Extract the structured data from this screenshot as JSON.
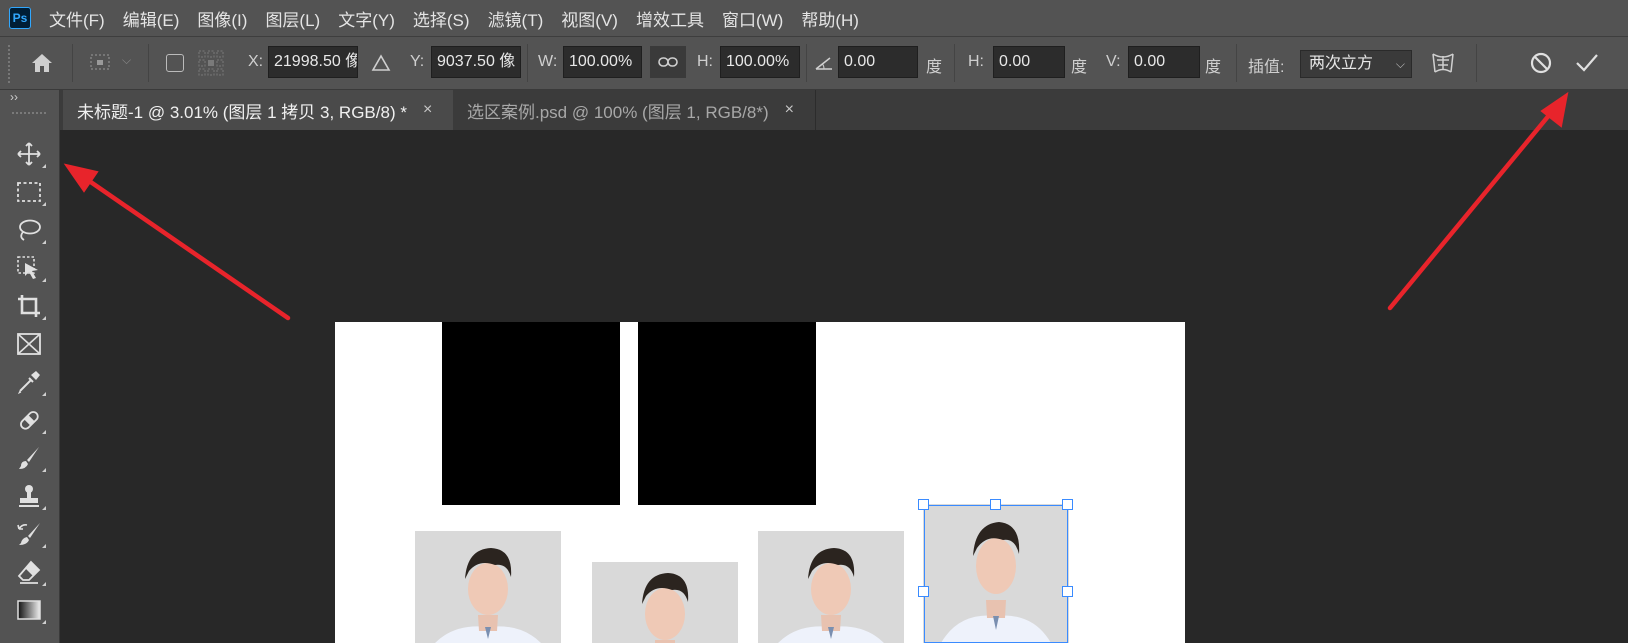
{
  "menu": {
    "items": [
      "文件(F)",
      "编辑(E)",
      "图像(I)",
      "图层(L)",
      "文字(Y)",
      "选择(S)",
      "滤镜(T)",
      "视图(V)",
      "增效工具",
      "窗口(W)",
      "帮助(H)"
    ]
  },
  "options": {
    "x_label": "X:",
    "x_value": "21998.50 像",
    "y_label": "Y:",
    "y_value": "9037.50 像",
    "w_label": "W:",
    "w_value": "100.00%",
    "h_label": "H:",
    "h_value": "100.00%",
    "angle_value": "0.00",
    "angle_unit": "度",
    "hskew_label": "H:",
    "hskew_value": "0.00",
    "hskew_unit": "度",
    "vskew_label": "V:",
    "vskew_value": "0.00",
    "vskew_unit": "度",
    "interp_label": "插值:",
    "interp_value": "两次立方"
  },
  "tabs": [
    {
      "label": "未标题-1 @ 3.01% (图层 1 拷贝 3, RGB/8) *",
      "close": "×"
    },
    {
      "label": "选区案例.psd @ 100% (图层 1, RGB/8*)",
      "close": "×"
    }
  ],
  "toolbar": {
    "collapse": "››",
    "tools": [
      "move-tool",
      "marquee-tool",
      "lasso-tool",
      "object-select-tool",
      "crop-tool",
      "frame-tool",
      "eyedropper-tool",
      "healing-tool",
      "brush-tool",
      "stamp-tool",
      "history-brush-tool",
      "eraser-tool",
      "gradient-tool"
    ]
  },
  "annotations": {
    "arrow_color": "#e8242b"
  }
}
